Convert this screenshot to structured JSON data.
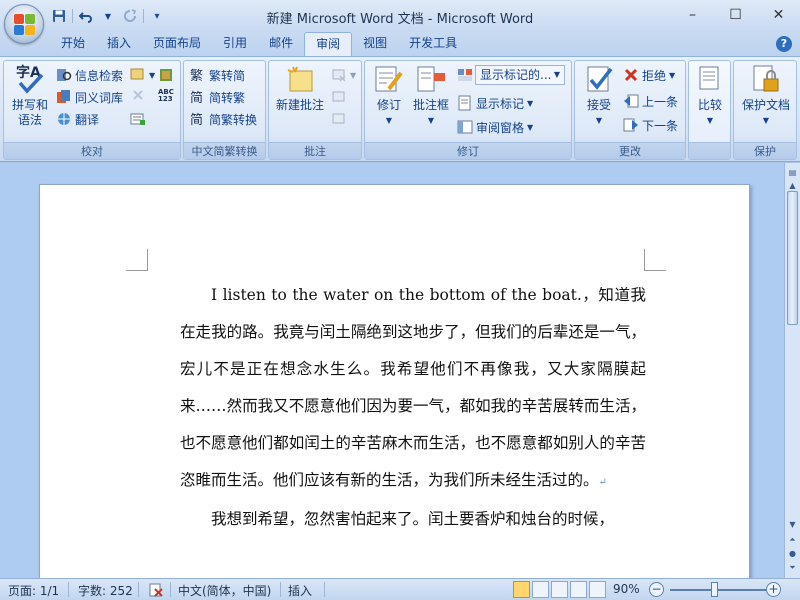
{
  "title_bar": {
    "title": "新建 Microsoft Word 文档 - Microsoft Word",
    "qat_icons": [
      "save-icon",
      "undo-icon",
      "redo-icon",
      "customize-qat-icon"
    ],
    "window_controls": {
      "minimize": "–",
      "maximize": "☐",
      "close": "✕"
    }
  },
  "tabs": [
    {
      "label": "开始",
      "active": false
    },
    {
      "label": "插入",
      "active": false
    },
    {
      "label": "页面布局",
      "active": false
    },
    {
      "label": "引用",
      "active": false
    },
    {
      "label": "邮件",
      "active": false
    },
    {
      "label": "审阅",
      "active": true
    },
    {
      "label": "视图",
      "active": false
    },
    {
      "label": "开发工具",
      "active": false
    }
  ],
  "help_glyph": "?",
  "ribbon": {
    "proofing": {
      "label": "校对",
      "spelling_line1": "拼写和",
      "spelling_line2": "语法",
      "research": "信息检索",
      "thesaurus": "同义词库",
      "translate": "翻译",
      "abc_badge": "ABC\n123"
    },
    "chinese_conversion": {
      "label": "中文简繁转换",
      "to_simplified": "繁转简",
      "to_traditional": "简转繁",
      "convert": "简繁转换"
    },
    "comments": {
      "label": "批注",
      "new_comment": "新建批注"
    },
    "tracking": {
      "label": "修订",
      "track_changes": "修订",
      "balloons": "批注框",
      "display_for_review": "显示标记的...",
      "show_markup": "显示标记",
      "reviewing_pane": "审阅窗格"
    },
    "changes": {
      "label": "更改",
      "accept": "接受",
      "reject": "拒绝",
      "previous": "上一条",
      "next": "下一条"
    },
    "compare": {
      "label": "",
      "compare": "比较"
    },
    "protect": {
      "label": "保护",
      "protect_document": "保护文档"
    }
  },
  "document": {
    "paragraph1": "I listen to the water on the bottom of the boat.，知道我在走我的路。我竟与闰土隔绝到这地步了，但我们的后辈还是一气，宏儿不是正在想念水生么。我希望他们不再像我，又大家隔膜起来……然而我又不愿意他们因为要一气，都如我的辛苦展转而生活，也不愿意他们都如闰土的辛苦麻木而生活，也不愿意都如别人的辛苦恣睢而生活。他们应该有新的生活，为我们所未经生活过的。",
    "paragraph_mark": "↵",
    "paragraph2": "我想到希望，忽然害怕起来了。闰土要香炉和烛台的时候，"
  },
  "status_bar": {
    "page": "页面: 1/1",
    "word_count": "字数: 252",
    "language": "中文(简体，中国)",
    "insert_mode": "插入",
    "zoom": "90%"
  },
  "colors": {
    "ribbon_text": "#15428b",
    "workspace": "#aecbf1",
    "spell_underline": "#38a838"
  }
}
